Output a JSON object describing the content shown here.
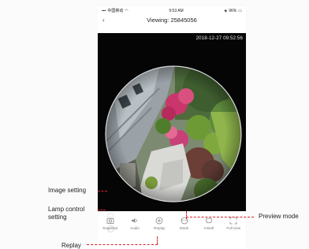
{
  "status_bar": {
    "carrier": "中国移动",
    "time": "9:53 AM",
    "battery": "96%"
  },
  "header": {
    "title": "Viewing: 25845056"
  },
  "video": {
    "timestamp": "2018-12-27 09:52:56"
  },
  "toolbar": {
    "items": [
      {
        "label": "Snapshot",
        "icon": "camera-icon"
      },
      {
        "label": "Audio",
        "icon": "speaker-icon"
      },
      {
        "label": "Replay",
        "icon": "replay-icon"
      },
      {
        "label": "Mode",
        "icon": "mode-icon"
      },
      {
        "label": "Install",
        "icon": "install-icon"
      },
      {
        "label": "Full view",
        "icon": "fullscreen-icon"
      }
    ]
  },
  "annotations": {
    "image_setting": "Image setting",
    "lamp_control_line1": "Lamp control",
    "lamp_control_line2": "setting",
    "preview_mode": "Preview mode",
    "replay": "Replay"
  },
  "colors": {
    "annotation_line": "#d3232a",
    "video_background": "#050505"
  }
}
